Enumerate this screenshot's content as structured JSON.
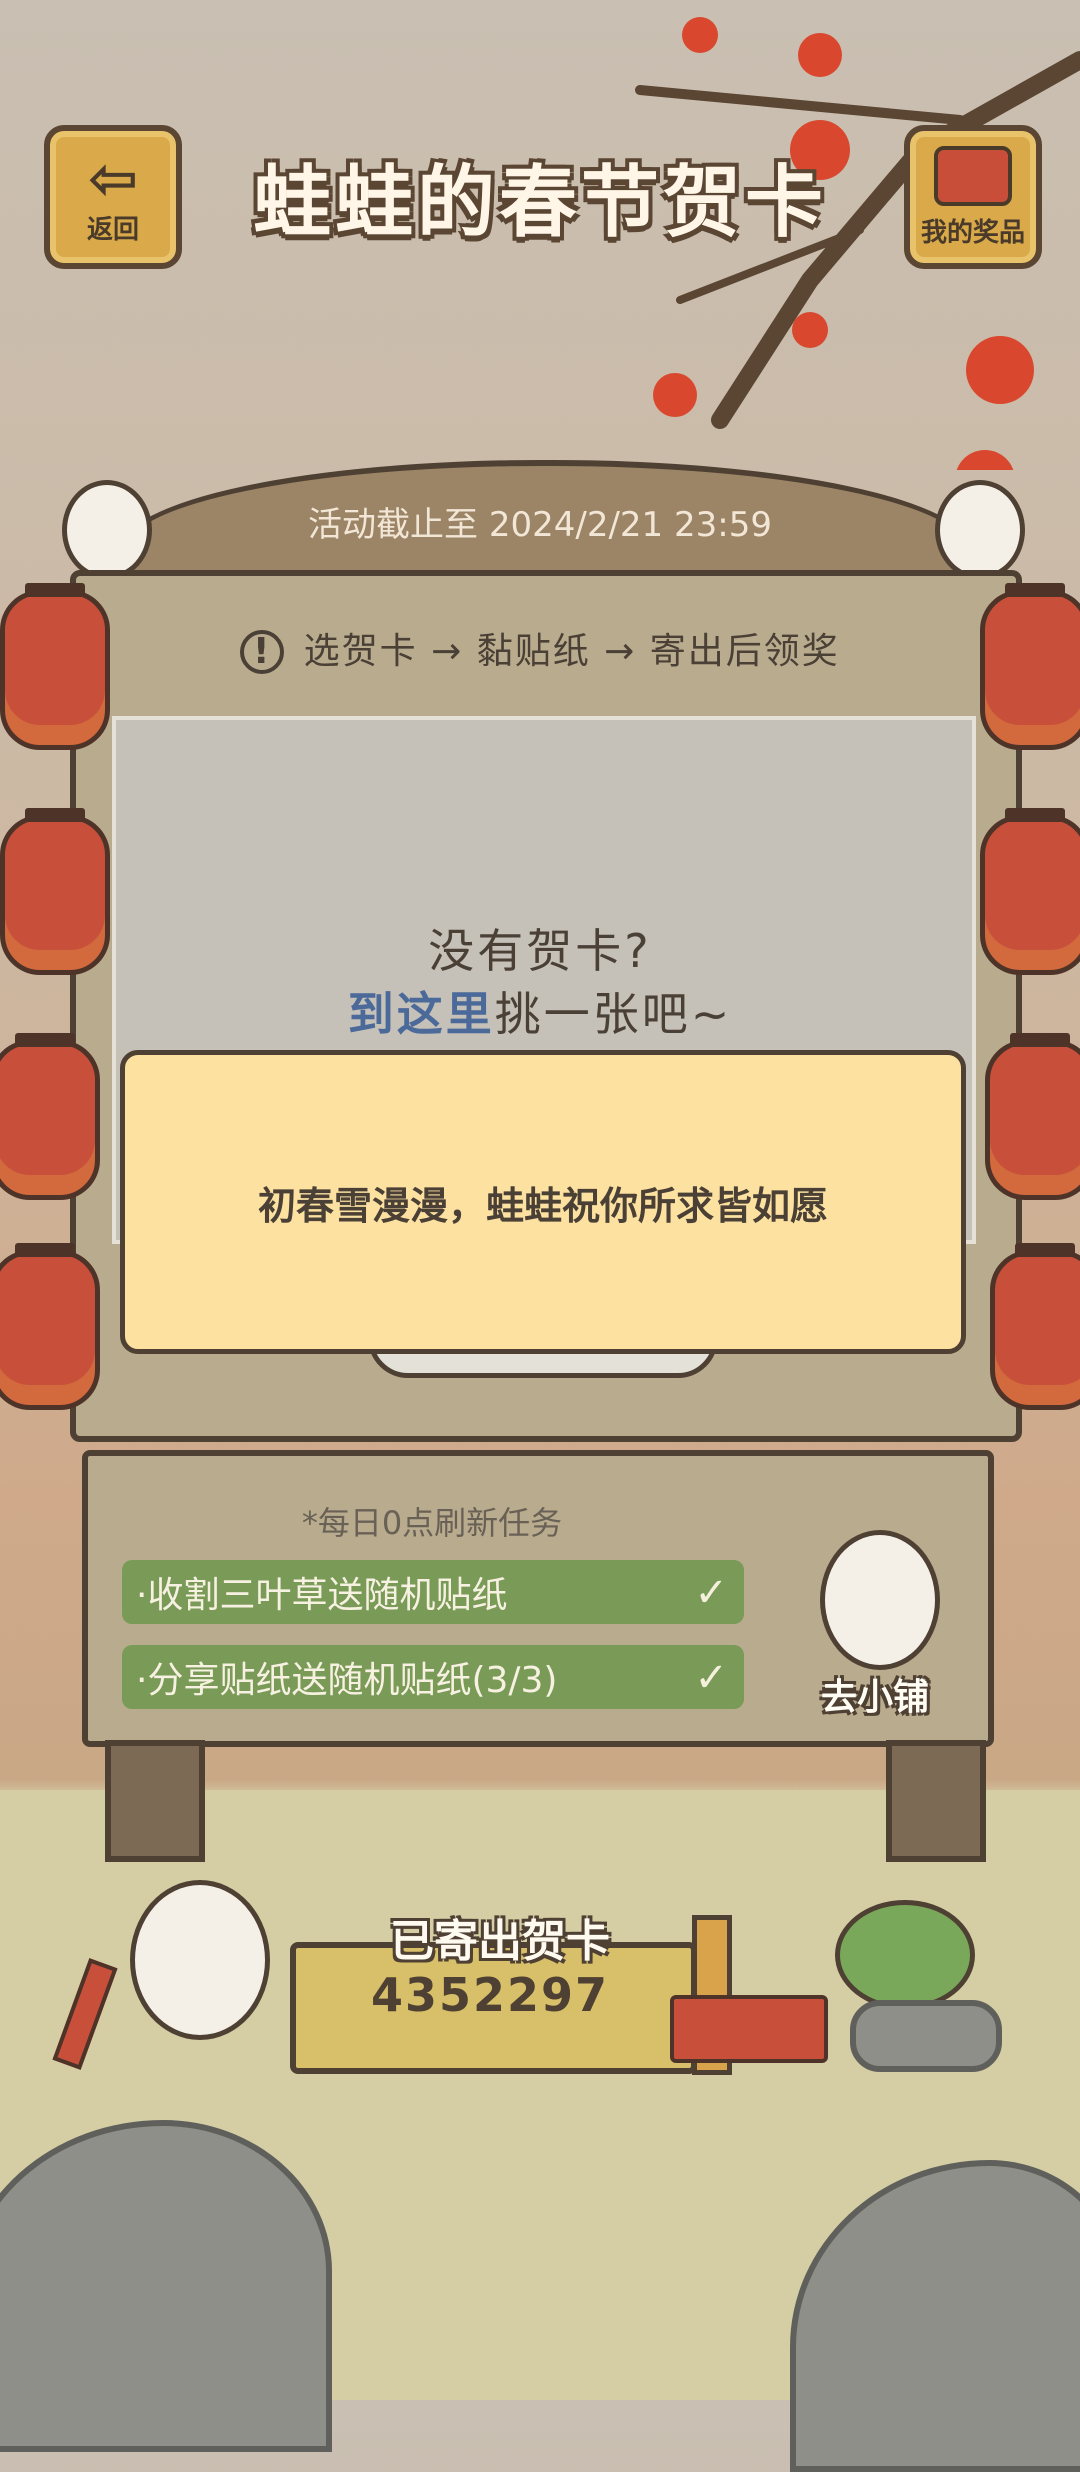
{
  "header": {
    "back_label": "返回",
    "title": "蛙蛙的春节贺卡",
    "prizes_label": "我的奖品"
  },
  "event": {
    "deadline": "活动截止至 2024/2/21 23:59",
    "instruction": "选贺卡 → 黏贴纸 → 寄出后领奖"
  },
  "card_area": {
    "empty_question": "没有贺卡?",
    "link_text": "到这里",
    "link_suffix": "挑一张吧~"
  },
  "toast": {
    "message": "初春雪漫漫，蛙蛙祝你所求皆如愿"
  },
  "tasks": {
    "refresh_hint": "*每日0点刷新任务",
    "items": [
      {
        "label": "·收割三叶草送随机贴纸",
        "done": true
      },
      {
        "label": "·分享贴纸送随机贴纸(3/3)",
        "done": true
      }
    ],
    "shop_label": "去小铺"
  },
  "sent": {
    "label": "已寄出贺卡",
    "count": "4352297"
  },
  "colors": {
    "board": "#b9ac8e",
    "wood_dark": "#4e4032",
    "task_green": "#7a9a58",
    "toast_bg": "#fde1a0",
    "lantern_red": "#c8503a",
    "link_blue": "#4b6a9a"
  },
  "icons": {
    "back": "arrow-left-icon",
    "prizes": "treasure-chest-icon",
    "info": "exclamation-circle-icon",
    "check": "check-icon"
  }
}
